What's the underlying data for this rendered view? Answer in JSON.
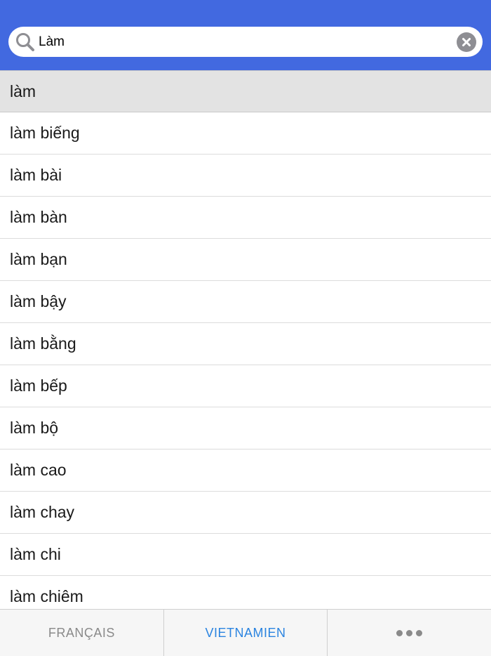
{
  "search": {
    "value": "Làm",
    "icon": "search-icon",
    "clear_icon": "close-icon"
  },
  "results": [
    "làm",
    "làm biếng",
    "làm bài",
    "làm bàn",
    "làm bạn",
    "làm bậy",
    "làm bằng",
    "làm bếp",
    "làm bộ",
    "làm cao",
    "làm chay",
    "làm chi",
    "làm chiêm"
  ],
  "selected_index": 0,
  "tabs": [
    {
      "label": "FRANÇAIS",
      "active": false
    },
    {
      "label": "VIETNAMIEN",
      "active": true
    },
    {
      "label": "",
      "icon": "more-icon",
      "active": false
    }
  ],
  "colors": {
    "header": "#4269e0",
    "active_tab": "#2b84e0",
    "inactive_tab": "#8a8a8a",
    "selected_row": "#e3e3e3"
  }
}
